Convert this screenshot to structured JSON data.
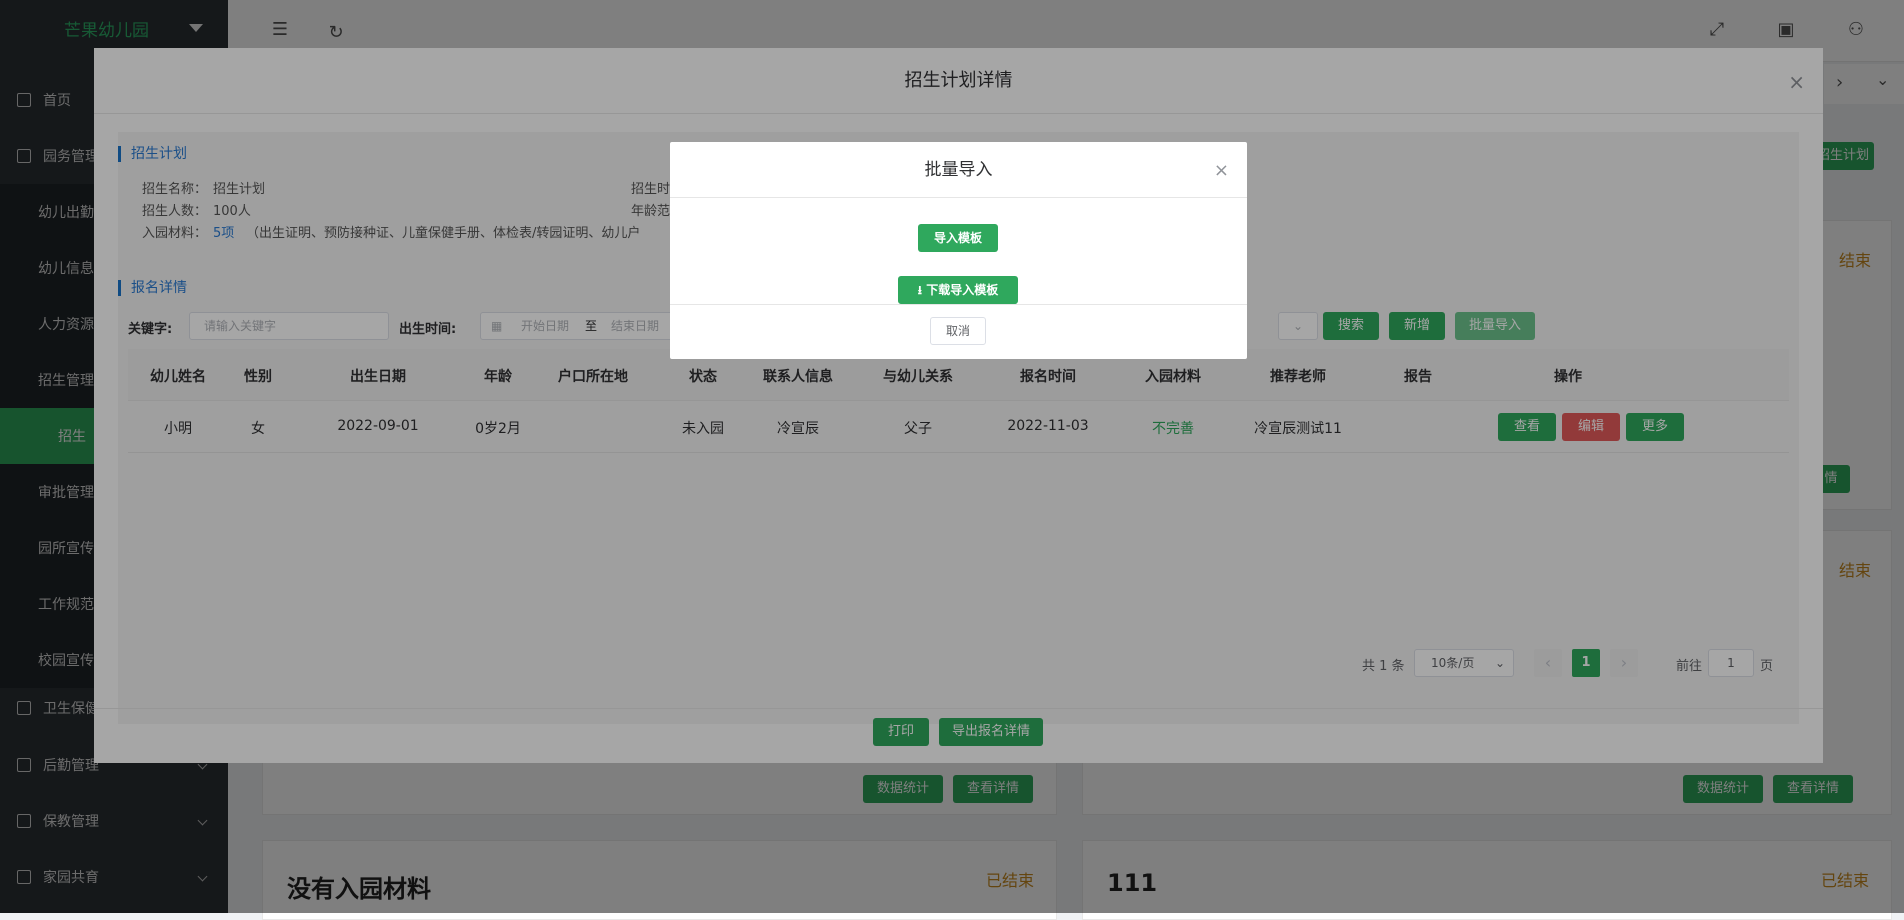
{
  "sidebar": {
    "logo": "芒果幼儿园",
    "items": [
      {
        "label": "首页"
      },
      {
        "label": "园务管理"
      },
      {
        "label": "幼儿出勤"
      },
      {
        "label": "幼儿信息"
      },
      {
        "label": "人力资源"
      },
      {
        "label": "招生管理"
      },
      {
        "label": "招生"
      },
      {
        "label": "审批管理"
      },
      {
        "label": "园所宣传"
      },
      {
        "label": "工作规范"
      },
      {
        "label": "校园宣传"
      },
      {
        "label": "卫生保健"
      },
      {
        "label": "后勤管理"
      },
      {
        "label": "保教管理"
      },
      {
        "label": "家园共育"
      }
    ]
  },
  "background": {
    "top_right_button": "招生计划",
    "status_labels": [
      "结束",
      "结束",
      "已结束",
      "已结束"
    ],
    "card_buttons": [
      "数据统计",
      "查看详情",
      "数据统计",
      "查看详情"
    ],
    "right_edge_button": "情",
    "card_titles": [
      "没有入园材料",
      "111"
    ]
  },
  "dialog": {
    "title": "招生计划详情",
    "plan_section": "招生计划",
    "plan_name_label": "招生名称：",
    "plan_name": "招生计划",
    "plan_time_label": "招生时",
    "plan_count_label": "招生人数：",
    "plan_count": "100人",
    "age_label": "年龄范",
    "materials_label": "入园材料：",
    "materials_count": "5项",
    "materials_list": "（出生证明、预防接种证、儿童保健手册、体检表/转园证明、幼儿户",
    "signup_section": "报名详情",
    "keyword_label": "关键字:",
    "keyword_placeholder": "请输入关键字",
    "birth_label": "出生时间:",
    "start_date": "开始日期",
    "date_sep": "至",
    "end_date": "结束日期",
    "search_btn": "搜索",
    "add_btn": "新增",
    "import_btn": "批量导入",
    "columns": [
      "幼儿姓名",
      "性别",
      "出生日期",
      "年龄",
      "户口所在地",
      "状态",
      "联系人信息",
      "与幼儿关系",
      "报名时间",
      "入园材料",
      "推荐老师",
      "报告",
      "操作"
    ],
    "rows": [
      {
        "name": "小明",
        "gender": "女",
        "birth": "2022-09-01",
        "age": "0岁2月",
        "hukou": "",
        "status": "未入园",
        "contact": "冷宣辰",
        "relation": "父子",
        "signup_time": "2022-11-03",
        "materials": "不完善",
        "teacher": "冷宣辰测试11",
        "report": "",
        "actions": [
          "查看",
          "编辑",
          "更多"
        ]
      }
    ],
    "pagination": {
      "total": "共 1 条",
      "page_size": "10条/页",
      "current": "1",
      "goto_label": "前往",
      "goto_value": "1",
      "page_suffix": "页"
    },
    "footer_buttons": [
      "打印",
      "导出报名详情"
    ]
  },
  "import_dialog": {
    "title": "批量导入",
    "import_template": "导入模板",
    "download_template": "下载导入模板",
    "cancel": "取消"
  },
  "colors": {
    "green": "#2fa85d",
    "red": "#e05a5a",
    "blue": "#1a73c9",
    "sidebar": "#2b3035"
  }
}
